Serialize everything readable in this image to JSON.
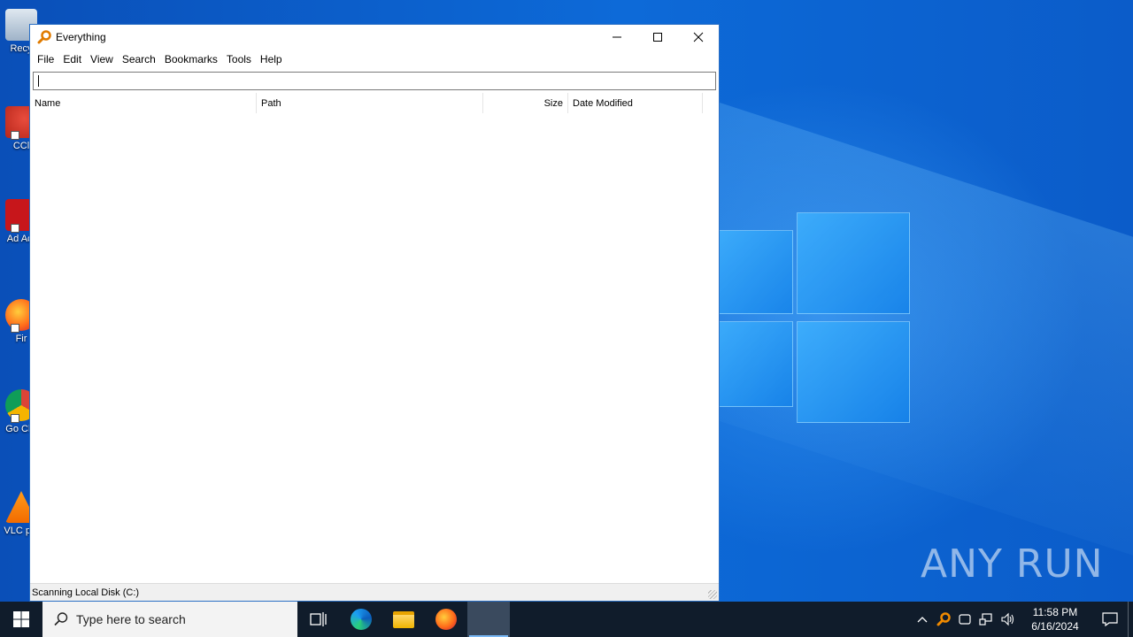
{
  "window": {
    "title": "Everything",
    "menu": [
      "File",
      "Edit",
      "View",
      "Search",
      "Bookmarks",
      "Tools",
      "Help"
    ],
    "search": {
      "value": "",
      "placeholder": ""
    },
    "columns": [
      "Name",
      "Path",
      "Size",
      "Date Modified"
    ],
    "status": "Scanning Local Disk (C:)"
  },
  "desktop": {
    "icons": [
      {
        "label": "Recy",
        "icon": "recycle-bin-icon"
      },
      {
        "label": "CCl",
        "icon": "ccleaner-icon"
      },
      {
        "label": "Ad Acr",
        "icon": "acrobat-icon"
      },
      {
        "label": "Fir",
        "icon": "firefox-icon"
      },
      {
        "label": "Go Chr",
        "icon": "chrome-icon"
      },
      {
        "label": "VLC pla",
        "icon": "vlc-icon"
      }
    ],
    "watermark": "ANY RUN"
  },
  "taskbar": {
    "search_placeholder": "Type here to search",
    "clock_time": "11:58 PM",
    "clock_date": "6/16/2024",
    "pinned": [
      "task-view-icon",
      "edge-icon",
      "file-explorer-icon",
      "firefox-icon",
      "everything-icon"
    ]
  },
  "colors": {
    "accent": "#0d6ad8",
    "taskbar": "#101c2b",
    "window_border": "#2b6fc4"
  }
}
